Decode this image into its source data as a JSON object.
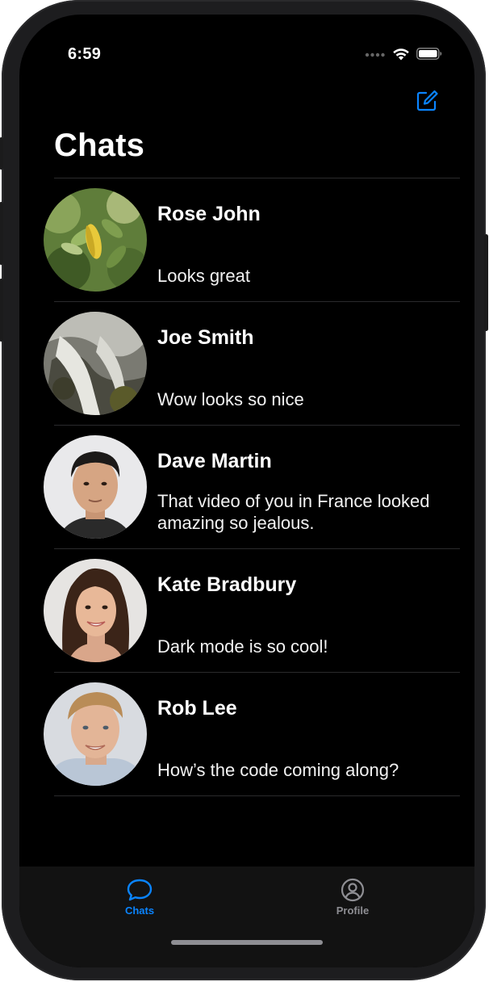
{
  "status_bar": {
    "time": "6:59",
    "icons": [
      "signal-icon",
      "wifi-icon",
      "battery-icon"
    ]
  },
  "header": {
    "title": "Chats",
    "compose_icon": "compose-icon"
  },
  "chats": [
    {
      "name": "Rose John",
      "message": "Looks great"
    },
    {
      "name": "Joe Smith",
      "message": "Wow looks so nice"
    },
    {
      "name": "Dave Martin",
      "message": "That video of you in France looked amazing so jealous."
    },
    {
      "name": "Kate Bradbury",
      "message": "Dark mode is so cool!"
    },
    {
      "name": "Rob Lee",
      "message": "How’s the code coming along?"
    }
  ],
  "tabbar": {
    "tabs": [
      {
        "label": "Chats",
        "icon": "chat-bubble-icon",
        "active": true
      },
      {
        "label": "Profile",
        "icon": "person-circle-icon",
        "active": false
      }
    ]
  },
  "colors": {
    "accent": "#0a84ff",
    "background": "#000000",
    "separator": "#2a2a2c",
    "inactive_tab": "#8e8e93"
  }
}
